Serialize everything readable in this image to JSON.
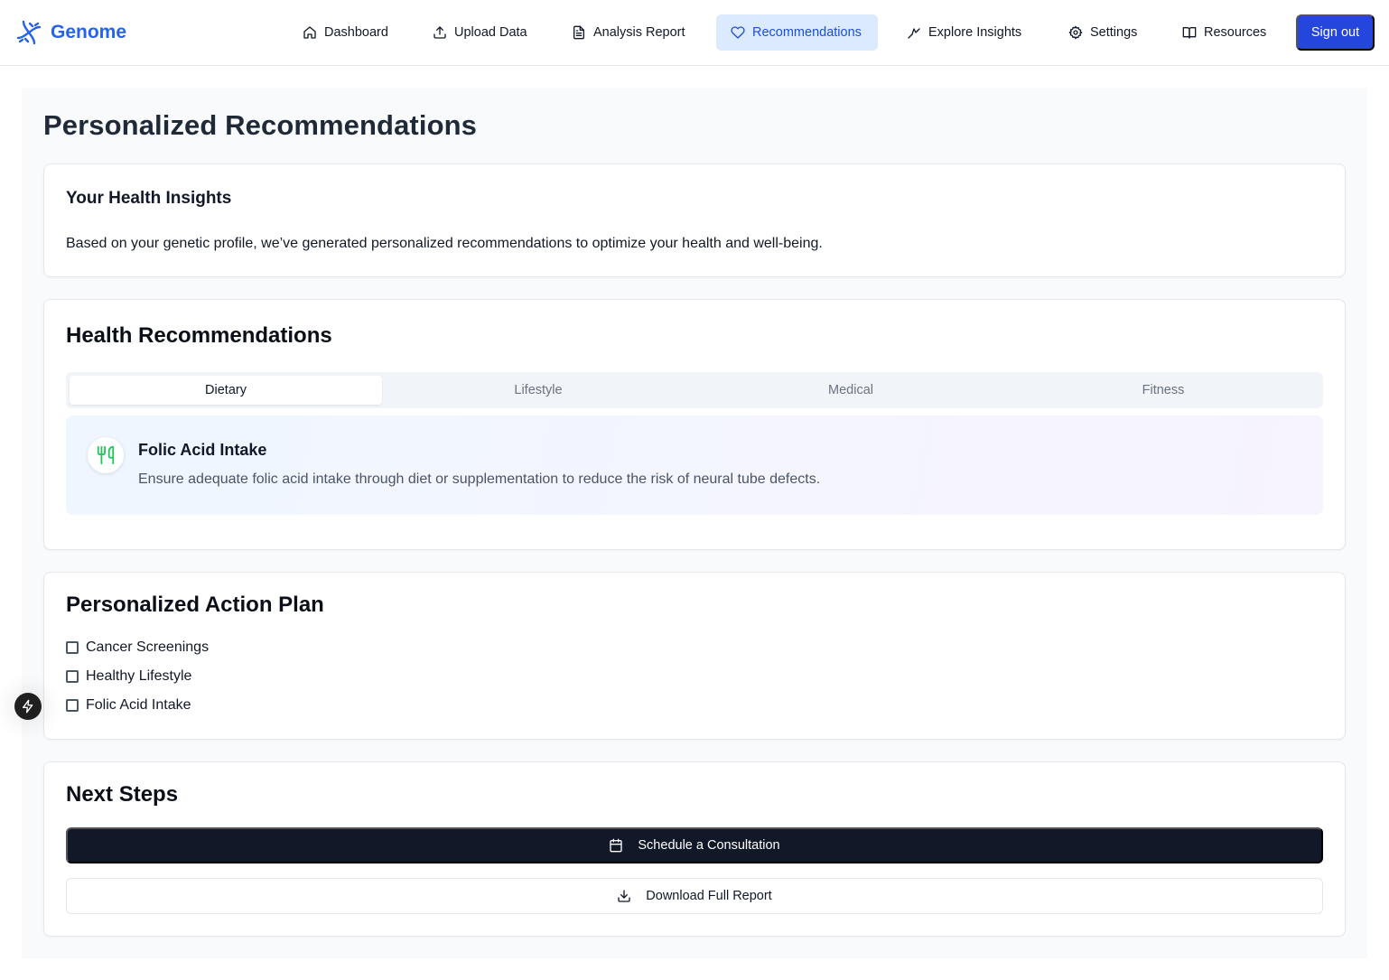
{
  "app": {
    "name": "Genome"
  },
  "nav": {
    "items": [
      {
        "label": "Dashboard",
        "icon": "home-icon"
      },
      {
        "label": "Upload Data",
        "icon": "upload-icon"
      },
      {
        "label": "Analysis Report",
        "icon": "file-text-icon"
      },
      {
        "label": "Recommendations",
        "icon": "heart-icon",
        "active": true
      },
      {
        "label": "Explore Insights",
        "icon": "activity-icon"
      },
      {
        "label": "Settings",
        "icon": "gear-icon"
      },
      {
        "label": "Resources",
        "icon": "book-open-icon"
      }
    ],
    "sign_out": "Sign out"
  },
  "page": {
    "title": "Personalized Recommendations"
  },
  "insights": {
    "title": "Your Health Insights",
    "text": "Based on your genetic profile, we’ve generated personalized recommendations to optimize your health and well-being."
  },
  "health": {
    "title": "Health Recommendations",
    "tabs": [
      "Dietary",
      "Lifestyle",
      "Medical",
      "Fitness"
    ],
    "active_tab": "Dietary",
    "recommendation": {
      "icon": "utensils-icon",
      "title": "Folic Acid Intake",
      "description": "Ensure adequate folic acid intake through diet or supplementation to reduce the risk of neural tube defects."
    }
  },
  "plan": {
    "title": "Personalized Action Plan",
    "items": [
      {
        "label": "Cancer Screenings",
        "checked": false
      },
      {
        "label": "Healthy Lifestyle",
        "checked": false
      },
      {
        "label": "Folic Acid Intake",
        "checked": false
      }
    ]
  },
  "next_steps": {
    "title": "Next Steps",
    "schedule": "Schedule a Consultation",
    "download": "Download Full Report"
  },
  "colors": {
    "brand": "#2563eb",
    "active_nav_bg": "#dbeafe",
    "sign_out_bg": "#2546dd",
    "primary_button": "#111827",
    "utensils_icon": "#22c55e"
  }
}
